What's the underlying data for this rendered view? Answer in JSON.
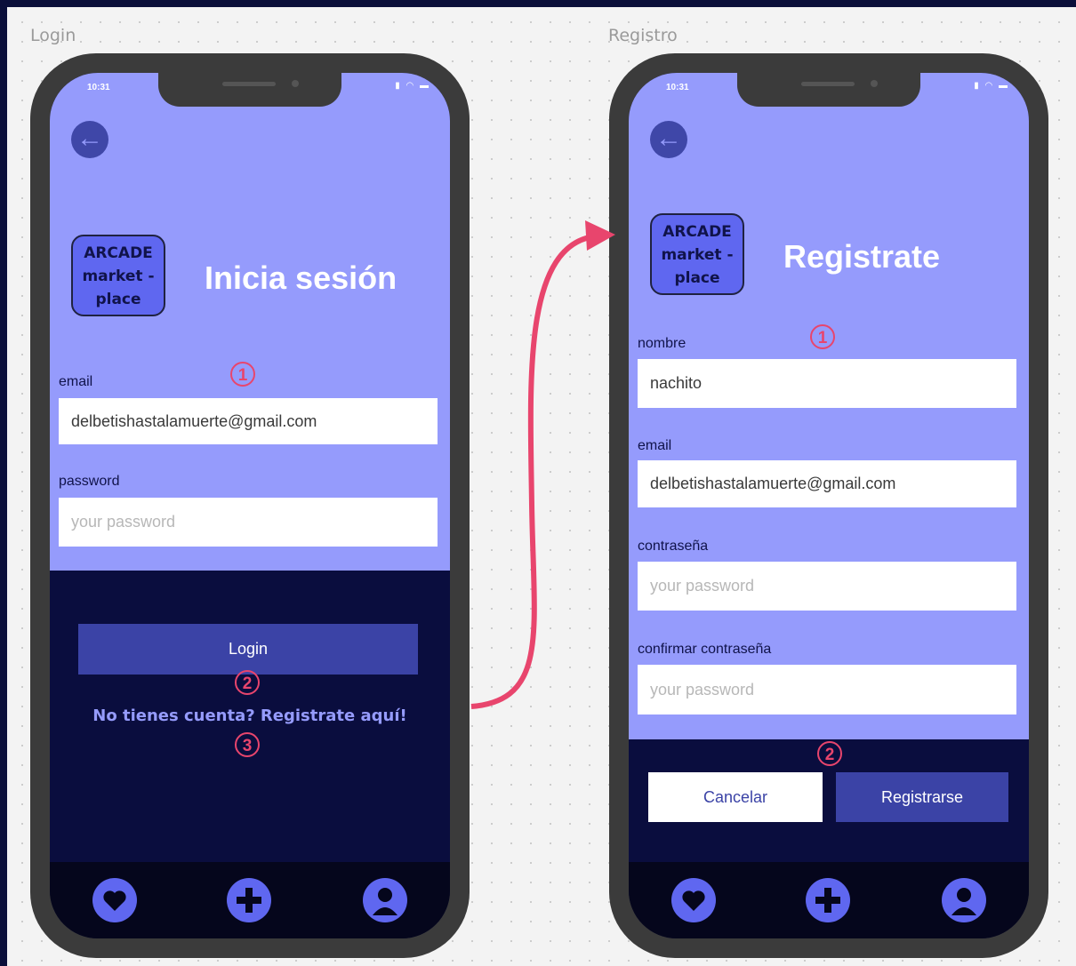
{
  "frames": {
    "login_label": "Login",
    "registro_label": "Registro"
  },
  "status": {
    "time": "10:31"
  },
  "login": {
    "logo_lines": [
      "ARCADE",
      "market -",
      "place"
    ],
    "title": "Inicia sesión",
    "email_label": "email",
    "email_value": "delbetishastalamuerte@gmail.com",
    "password_label": "password",
    "password_placeholder": "your password",
    "login_button": "Login",
    "register_link": "No tienes cuenta? Registrate aquí!"
  },
  "registro": {
    "logo_lines": [
      "ARCADE",
      "market -",
      "place"
    ],
    "title": "Registrate",
    "nombre_label": "nombre",
    "nombre_value": "nachito",
    "email_label": "email",
    "email_value": "delbetishastalamuerte@gmail.com",
    "password_label": "contraseña",
    "password_placeholder": "your password",
    "confirm_label": "confirmar contraseña",
    "confirm_placeholder": "your password",
    "cancel_button": "Cancelar",
    "submit_button": "Registrarse"
  },
  "annotations": {
    "one": "1",
    "two": "2",
    "three": "3"
  },
  "nav_icons": [
    "heart-icon",
    "plus-icon",
    "user-icon"
  ],
  "colors": {
    "screen_top": "#959bfc",
    "screen_bottom": "#0a0d3e",
    "accent": "#5f67f0",
    "button": "#3b43a6",
    "annotation": "#e8456d"
  }
}
